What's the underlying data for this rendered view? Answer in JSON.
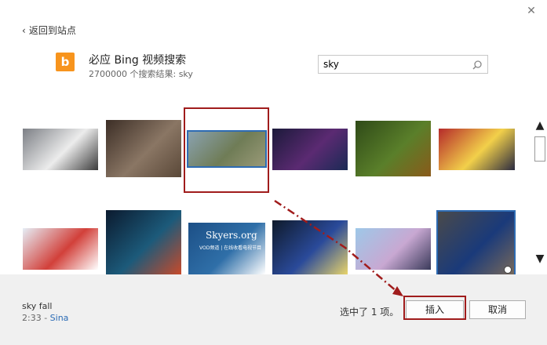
{
  "window": {
    "close_glyph": "✕"
  },
  "nav": {
    "back_label": "返回到站点"
  },
  "provider": {
    "logo_letter": "b",
    "title": "必应 Bing 视频搜索",
    "result_count": "2700000 个搜索结果: sky"
  },
  "search": {
    "value": "sky",
    "placeholder": ""
  },
  "results": [
    {
      "id": "r1",
      "colors": [
        "#7c7f85",
        "#ececec",
        "#3b3b3b"
      ]
    },
    {
      "id": "r2",
      "colors": [
        "#3c2e26",
        "#8a7664",
        "#5a4838"
      ]
    },
    {
      "id": "r3",
      "colors": [
        "#8aa2b0",
        "#6f7c56",
        "#9a9a78"
      ]
    },
    {
      "id": "r4",
      "colors": [
        "#1b1a3a",
        "#5b2a72",
        "#1a2a55"
      ]
    },
    {
      "id": "r5",
      "colors": [
        "#2f4a18",
        "#5a7f2a",
        "#8a5a1a"
      ]
    },
    {
      "id": "r6",
      "colors": [
        "#b52a2a",
        "#f2d04a",
        "#2a2a40"
      ]
    },
    {
      "id": "r7",
      "colors": [
        "#e6eef6",
        "#d2403a",
        "#ffffff"
      ]
    },
    {
      "id": "r8",
      "colors": [
        "#0b1a2e",
        "#1c5a7a",
        "#c84a2a"
      ]
    },
    {
      "id": "r9",
      "colors": [
        "#1c4f86",
        "#2f6fa8",
        "#ffffff"
      ]
    },
    {
      "id": "r10",
      "colors": [
        "#0f1a2a",
        "#2a4a9a",
        "#e8d46a"
      ]
    },
    {
      "id": "r11",
      "colors": [
        "#9ec8e8",
        "#c8a8d2",
        "#3a3a5a"
      ]
    },
    {
      "id": "r12",
      "colors": [
        "#4a4a4a",
        "#1a3a7a",
        "#7a6a5a"
      ]
    }
  ],
  "watermark": {
    "site": "Skyers.org",
    "cn": "VOD频道 | 在线收看电视节目"
  },
  "footer": {
    "clip_title": "sky fall",
    "clip_duration": "2:33",
    "clip_separator": " - ",
    "clip_source": "Sina",
    "selection_text": "选中了 1 项。",
    "insert_label": "插入",
    "cancel_label": "取消"
  },
  "colors": {
    "accent": "#2d6bb3",
    "annotation": "#a01c1c",
    "bing_orange": "#f7941d"
  }
}
